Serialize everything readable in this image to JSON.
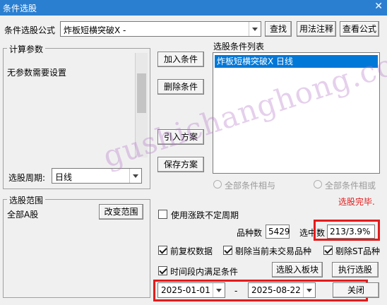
{
  "window": {
    "title": "条件选股",
    "close_glyph": "✕"
  },
  "formula": {
    "label": "条件选股公式",
    "value": "炸板短横突破X  -",
    "find_button": "查找",
    "usage_button": "用法注释",
    "view_button": "查看公式"
  },
  "params": {
    "group_title": "计算参数",
    "text": "无参数需要设置",
    "period_label": "选股周期:",
    "period_value": "日线"
  },
  "actions": {
    "add": "加入条件",
    "delete": "删除条件",
    "import": "引入方案",
    "save": "保存方案"
  },
  "conditions": {
    "title": "选股条件列表",
    "items": [
      "炸板短横突破X  日线"
    ],
    "and_label": "全部条件相与",
    "or_label": "全部条件相或"
  },
  "status": {
    "text": "选股完毕.",
    "color": "#e41b1b"
  },
  "scope": {
    "group_title": "选股范围",
    "value": "全部A股",
    "change_button": "改变范围"
  },
  "options": {
    "unfixed_period": "使用涨跌不定周期",
    "count_label": "品种数",
    "count_value": "5429",
    "selected_label": "选中数",
    "selected_value": "213/3.9%",
    "forward_adjusted": "前复权数据",
    "exclude_untraded": "剔除当前未交易品种",
    "exclude_st": "剔除ST品种",
    "time_range": "时间段内满足条件",
    "to_block_button": "选股入板块",
    "run_button": "执行选股"
  },
  "dates": {
    "start": "2025-01-01",
    "separator": "-",
    "end": "2025-08-22",
    "close_button": "关闭"
  },
  "watermark": "gushichanghong.com",
  "colors": {
    "title_bar": "#2b7fd0",
    "selection": "#0078d7",
    "highlight_box": "#e41b1b"
  }
}
